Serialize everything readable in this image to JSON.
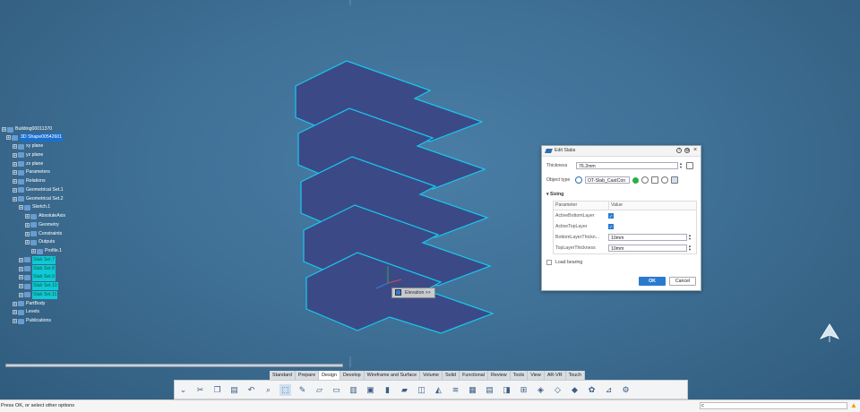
{
  "tree": {
    "root": "Building00011370",
    "shape": "3D Shape00542601",
    "items": [
      {
        "label": "xy plane",
        "level": 2
      },
      {
        "label": "yz plane",
        "level": 2
      },
      {
        "label": "zx plane",
        "level": 2
      },
      {
        "label": "Parameters",
        "level": 2
      },
      {
        "label": "Relations",
        "level": 2
      },
      {
        "label": "Geometrical Set.1",
        "level": 2
      },
      {
        "label": "Geometrical Set.2",
        "level": 2
      },
      {
        "label": "Sketch.1",
        "level": 3
      },
      {
        "label": "AbsoluteAxis",
        "level": 4
      },
      {
        "label": "Geometry",
        "level": 4
      },
      {
        "label": "Constraints",
        "level": 4
      },
      {
        "label": "Outputs",
        "level": 4
      },
      {
        "label": "Profile.1",
        "level": 5
      },
      {
        "label": "Slab Set.7",
        "level": 3,
        "sel": true
      },
      {
        "label": "Slab Set.8",
        "level": 3,
        "sel": true
      },
      {
        "label": "Slab Set.9",
        "level": 3,
        "sel": true
      },
      {
        "label": "Slab Set.10",
        "level": 3,
        "sel": true
      },
      {
        "label": "Slab Set.11",
        "level": 3,
        "sel": true
      },
      {
        "label": "PartBody",
        "level": 2
      },
      {
        "label": "Levels",
        "level": 2
      },
      {
        "label": "Publications",
        "level": 2
      }
    ]
  },
  "dialog": {
    "title": "Edit Slabs",
    "thickness_label": "Thickness",
    "thickness_value": "76.2mm",
    "object_type_label": "Object type",
    "object_type_value": "OT-Slab_CastCon",
    "sizing_label": "Sizing",
    "col_parameter": "Parameter",
    "col_value": "Value",
    "rows": [
      {
        "param": "ActiveBottomLayer",
        "value": "",
        "checked": true
      },
      {
        "param": "ActiveTopLayer",
        "value": "",
        "checked": true
      },
      {
        "param": "BottomLayerThickn...",
        "value": "10mm"
      },
      {
        "param": "TopLayerThickness",
        "value": "10mm"
      }
    ],
    "load_bearing_label": "Load bearing",
    "ok_label": "OK",
    "cancel_label": "Cancel"
  },
  "elevation_label": "Elevation >>",
  "tabs": [
    "Standard",
    "Prepare",
    "Design",
    "Develop",
    "Wireframe and Surface",
    "Volume",
    "Solid",
    "Functional",
    "Review",
    "Tools",
    "View",
    "AR-VR",
    "Touch"
  ],
  "active_tab": "Design",
  "status": {
    "message": "Press OK, or select other options",
    "cmd_prefix": "c"
  },
  "colors": {
    "slab_fill": "#3b4a86",
    "slab_edge": "#18c8f0",
    "accent": "#2a7bd0"
  }
}
